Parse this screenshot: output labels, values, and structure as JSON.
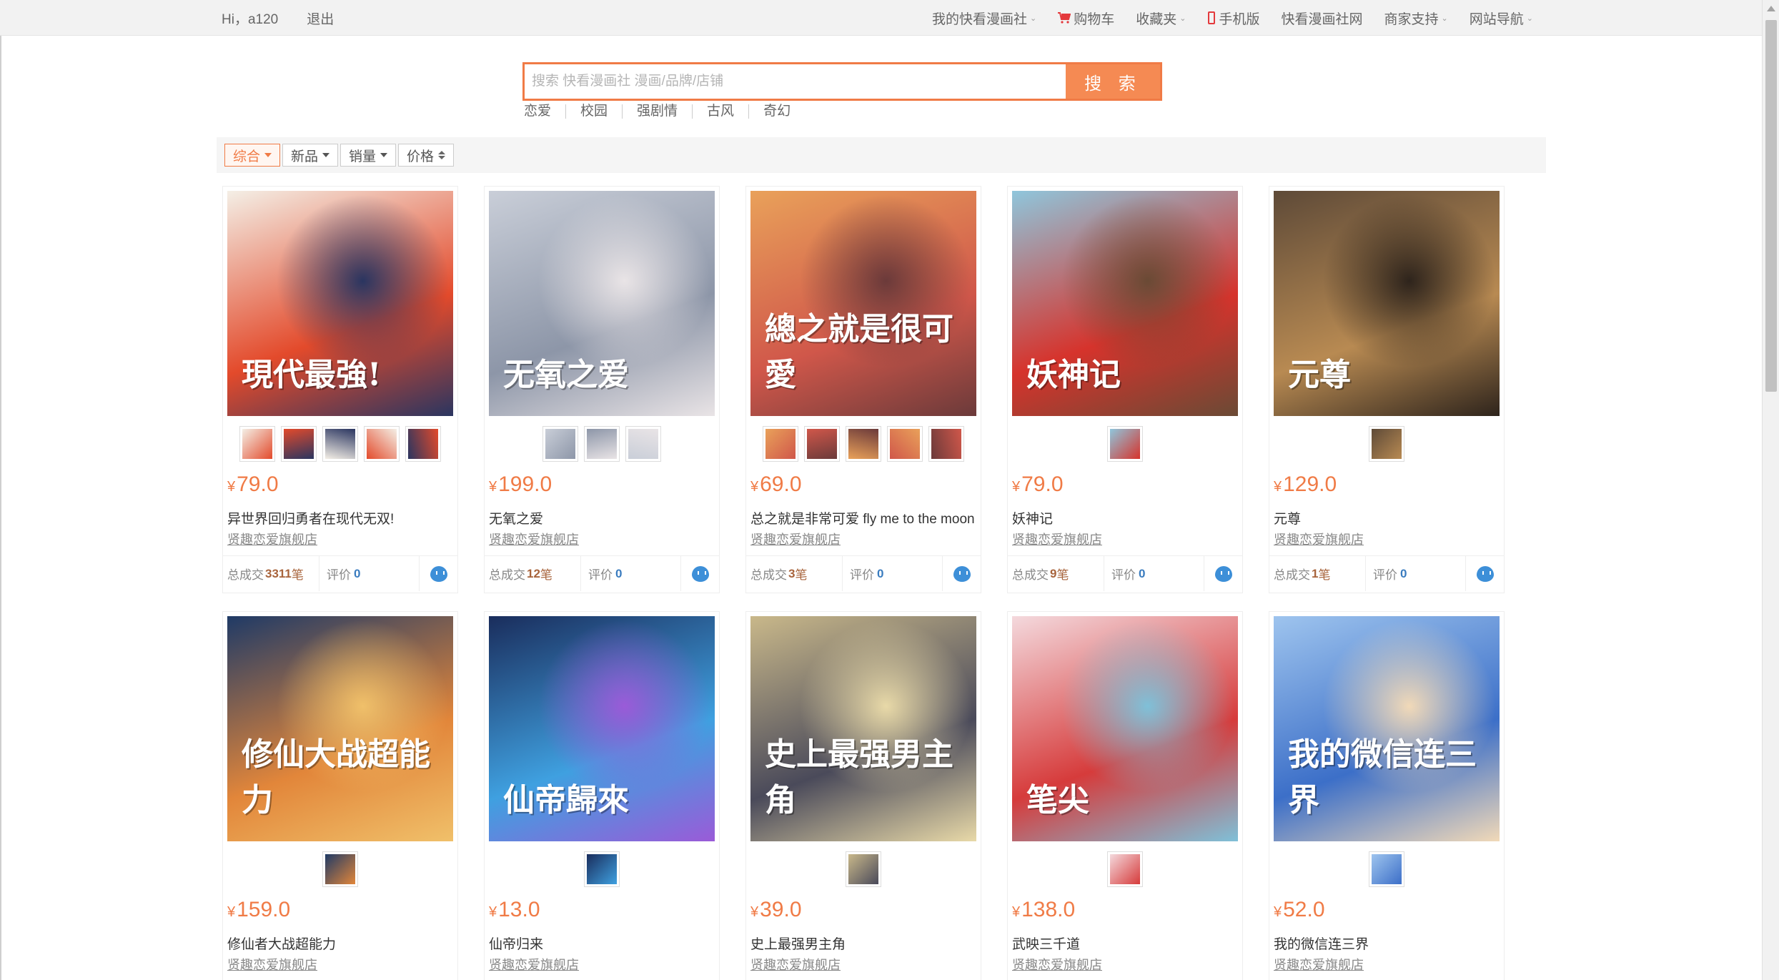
{
  "topbar": {
    "greeting": "Hi，a120",
    "logout": "退出",
    "nav": [
      {
        "label": "我的快看漫画社",
        "caret": true
      },
      {
        "label": "购物车",
        "icon": "cart-icon"
      },
      {
        "label": "收藏夹",
        "caret": true
      },
      {
        "label": "手机版",
        "icon": "phone-icon"
      },
      {
        "label": "快看漫画社网",
        "caret": false
      },
      {
        "label": "商家支持",
        "caret": true
      },
      {
        "label": "网站导航",
        "caret": true
      }
    ]
  },
  "search": {
    "placeholder": "搜索 快看漫画社 漫画/品牌/店铺",
    "button": "搜 索",
    "hotwords": [
      "恋爱",
      "校园",
      "强剧情",
      "古风",
      "奇幻"
    ]
  },
  "sort": {
    "options": [
      "综合",
      "新品",
      "销量",
      "价格"
    ],
    "active": "综合"
  },
  "labels": {
    "yen": "¥",
    "total_prefix": "总成交",
    "total_suffix": "笔",
    "review": "评价"
  },
  "products": [
    {
      "price": "79.0",
      "name": "异世界回归勇者在现代无双!",
      "shop": "贤趣恋爱旗舰店",
      "sales": "3311",
      "reviews": "0",
      "thumbs": 5,
      "cover_text": "現代最強!",
      "colors": [
        "#f4efe6",
        "#e34a2b",
        "#2a3560"
      ]
    },
    {
      "price": "199.0",
      "name": "无氧之爱",
      "shop": "贤趣恋爱旗舰店",
      "sales": "12",
      "reviews": "0",
      "thumbs": 3,
      "cover_text": "无氧之爱",
      "colors": [
        "#c9ced8",
        "#8d96a8",
        "#e9e4e6"
      ]
    },
    {
      "price": "69.0",
      "name": "总之就是非常可爱 fly me to the moon",
      "shop": "贤趣恋爱旗舰店",
      "sales": "3",
      "reviews": "0",
      "thumbs": 5,
      "cover_text": "總之就是很可愛",
      "colors": [
        "#e9a15a",
        "#d0574a",
        "#6b3a3a"
      ]
    },
    {
      "price": "79.0",
      "name": "妖神记",
      "shop": "贤趣恋爱旗舰店",
      "sales": "9",
      "reviews": "0",
      "thumbs": 1,
      "cover_text": "妖神记",
      "colors": [
        "#8fc6dc",
        "#d6332c",
        "#6a4a35"
      ]
    },
    {
      "price": "129.0",
      "name": "元尊",
      "shop": "贤趣恋爱旗舰店",
      "sales": "1",
      "reviews": "0",
      "thumbs": 1,
      "cover_text": "元尊",
      "colors": [
        "#5e4a38",
        "#b88a52",
        "#2e241c"
      ]
    },
    {
      "price": "159.0",
      "name": "修仙者大战超能力",
      "shop": "贤趣恋爱旗舰店",
      "sales": "",
      "reviews": "",
      "thumbs": 1,
      "cover_text": "修仙大战超能力",
      "colors": [
        "#1f3a66",
        "#e2863a",
        "#f0c06a"
      ]
    },
    {
      "price": "13.0",
      "name": "仙帝归来",
      "shop": "贤趣恋爱旗舰店",
      "sales": "",
      "reviews": "",
      "thumbs": 1,
      "cover_text": "仙帝歸來",
      "colors": [
        "#1a2d5c",
        "#3fa0e0",
        "#9a5bd8"
      ]
    },
    {
      "price": "39.0",
      "name": "史上最强男主角",
      "shop": "贤趣恋爱旗舰店",
      "sales": "",
      "reviews": "",
      "thumbs": 1,
      "cover_text": "史上最强男主角",
      "colors": [
        "#c9b88a",
        "#4a4a5a",
        "#e8d9a8"
      ]
    },
    {
      "price": "138.0",
      "name": "武映三千道",
      "shop": "贤趣恋爱旗舰店",
      "sales": "",
      "reviews": "",
      "thumbs": 1,
      "cover_text": "笔尖",
      "colors": [
        "#f4d9dd",
        "#d63b3b",
        "#7fc0d8"
      ]
    },
    {
      "price": "52.0",
      "name": "我的微信连三界",
      "shop": "贤趣恋爱旗舰店",
      "sales": "",
      "reviews": "",
      "thumbs": 1,
      "cover_text": "我的微信连三界",
      "colors": [
        "#9ec4ee",
        "#3c6fc8",
        "#f1d9b8"
      ]
    }
  ]
}
